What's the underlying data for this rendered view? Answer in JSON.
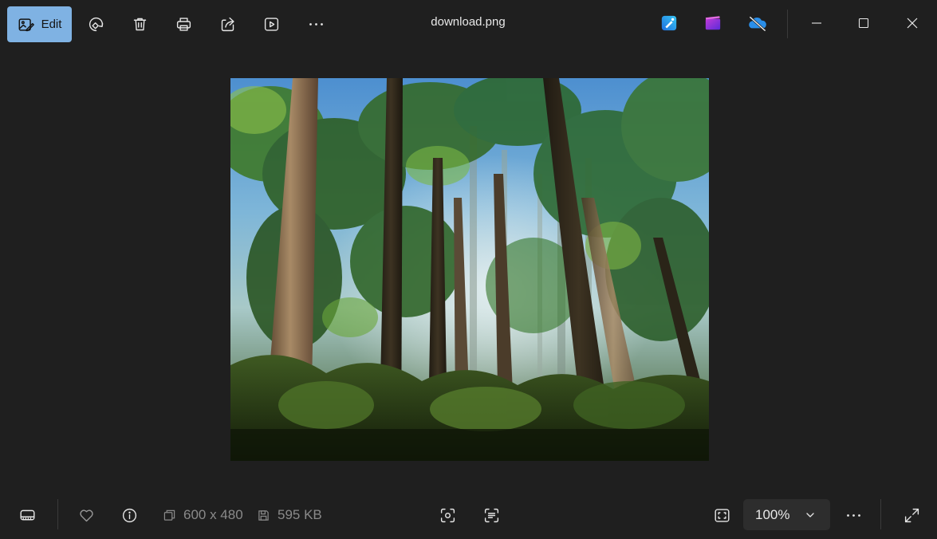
{
  "window": {
    "title": "download.png"
  },
  "toolbar": {
    "edit_label": "Edit",
    "icons": [
      "edit-image-icon",
      "rotate-icon",
      "delete-icon",
      "print-icon",
      "share-icon",
      "slideshow-icon",
      "more-icon"
    ]
  },
  "apps": [
    "designer-icon",
    "clipchamp-icon",
    "onedrive-icon"
  ],
  "image": {
    "width": 600,
    "height": 480
  },
  "status": {
    "dimensions": "600 x 480",
    "file_size": "595 KB"
  },
  "zoom": {
    "level": "100%"
  },
  "colors": {
    "background": "#1f1f1f",
    "accent": "#7fb2e3",
    "zoom_box": "#2d2d2d",
    "muted_text": "#8a8a8a"
  }
}
